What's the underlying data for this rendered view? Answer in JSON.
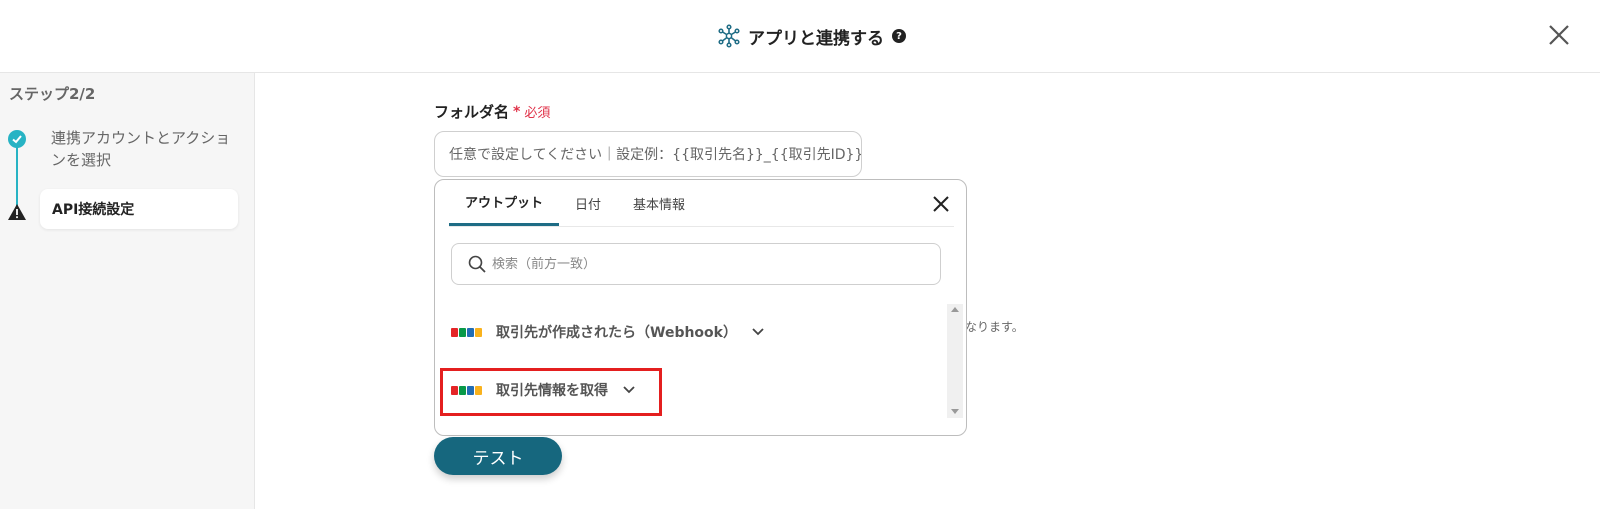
{
  "header": {
    "title": "アプリと連携する",
    "help": "?"
  },
  "sidebar": {
    "step_label": "ステップ2/2",
    "steps": [
      {
        "label": "連携アカウントとアクションを選択",
        "status": "done"
      },
      {
        "label": "API接続設定",
        "status": "current"
      }
    ]
  },
  "form": {
    "folder_label": "フォルダ名",
    "required_mark": "*",
    "required_text": "必須",
    "folder_placeholder": "任意で設定してください｜設定例：{{取引先名}}_{{取引先ID}}",
    "hint_tail": "なります。"
  },
  "popup": {
    "tabs": [
      {
        "label": "アウトプット",
        "active": true
      },
      {
        "label": "日付",
        "active": false
      },
      {
        "label": "基本情報",
        "active": false
      }
    ],
    "search_placeholder": "検索（前方一致）",
    "items": [
      {
        "label": "取引先が作成されたら（Webhook）",
        "icon": "zoho-logo"
      },
      {
        "label": "取引先情報を取得",
        "icon": "zoho-logo",
        "highlighted": true
      }
    ]
  },
  "test_button_label": "テスト",
  "colors": {
    "accent": "#16677e",
    "step_line": "#27b3c4",
    "required": "#e0334a",
    "highlight": "#e41f1f"
  }
}
